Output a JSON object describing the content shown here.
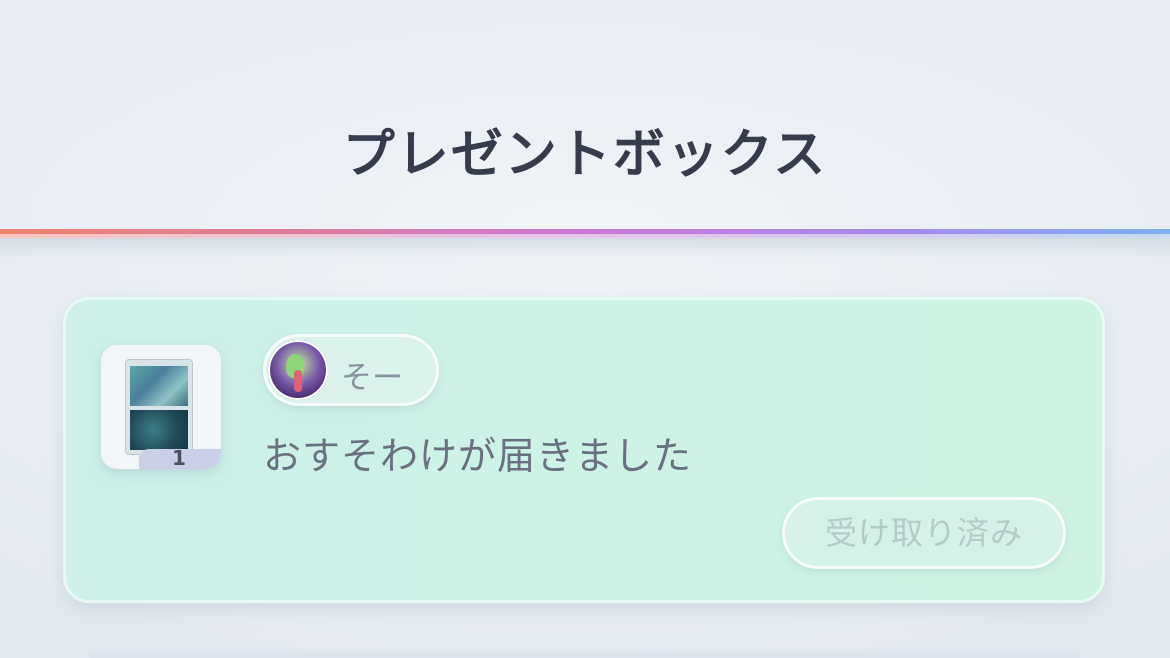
{
  "header": {
    "title": "プレゼントボックス"
  },
  "colors": {
    "accent_gradient": [
      "#f08070",
      "#e07c9c",
      "#c47ad6",
      "#a888ea",
      "#7fb0ea"
    ],
    "card_background": "#cdf2e6",
    "title_text": "#363c4b"
  },
  "present_items": [
    {
      "thumbnail": {
        "icon": "pokemon-card-icon",
        "quantity": "1"
      },
      "sender": {
        "avatar_icon": "user-avatar-icon",
        "name": "そー"
      },
      "message": "おすそわけが届きました",
      "status_button_label": "受け取り済み"
    }
  ]
}
